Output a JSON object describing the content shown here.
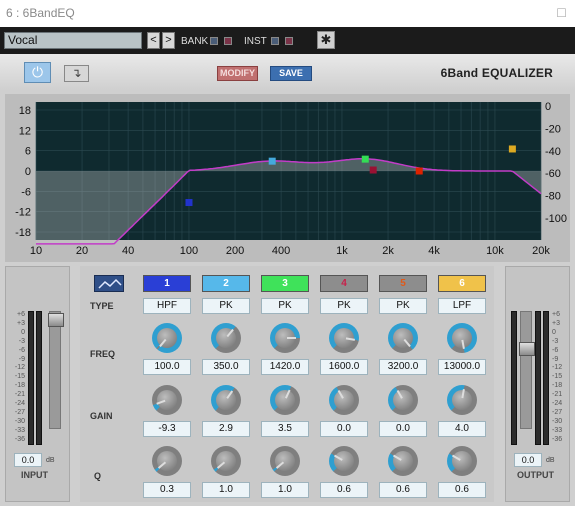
{
  "window": {
    "title": "6 : 6BandEQ",
    "close_glyph": "□"
  },
  "toolbar": {
    "preset": "Vocal",
    "prev": "<",
    "next": ">",
    "bank_label": "BANK",
    "inst_label": "INST",
    "gear_glyph": "✱"
  },
  "header": {
    "power_glyph": "⏻",
    "bypass_glyph": "↴",
    "modify_label": "MODIFY",
    "save_label": "SAVE",
    "brand": "6Band EQUALIZER"
  },
  "graph": {
    "left_ticks": [
      "18",
      "12",
      "6",
      "0",
      "-6",
      "-12",
      "-18"
    ],
    "right_ticks": [
      "0",
      "-20",
      "-40",
      "-60",
      "-80",
      "-100"
    ],
    "freq_ticks": [
      "10",
      "20",
      "40",
      "100",
      "200",
      "400",
      "1k",
      "2k",
      "4k",
      "10k",
      "20k"
    ],
    "curve_color": "#c23cc8",
    "node_colors": [
      "#2233cc",
      "#44aadd",
      "#33dd55",
      "#991133",
      "#dd2200",
      "#ddaa22"
    ],
    "nodes": [
      {
        "freq": 100,
        "gain": -9.3
      },
      {
        "freq": 350,
        "gain": 2.9
      },
      {
        "freq": 1420,
        "gain": 3.5
      },
      {
        "freq": 1600,
        "gain": 0.0
      },
      {
        "freq": 3200,
        "gain": 0.0
      },
      {
        "freq": 13000,
        "gain": 4.0
      }
    ]
  },
  "rows": {
    "type": "TYPE",
    "freq": "FREQ",
    "gain": "GAIN",
    "q": "Q"
  },
  "bands": [
    {
      "num": "1",
      "color": "#2a3fd6",
      "text_color": "#ffffff",
      "type": "HPF",
      "freq": "100.0",
      "gain": "-9.3",
      "q": "0.3"
    },
    {
      "num": "2",
      "color": "#56b8ea",
      "text_color": "#ffffff",
      "type": "PK",
      "freq": "350.0",
      "gain": "2.9",
      "q": "1.0"
    },
    {
      "num": "3",
      "color": "#3fe25a",
      "text_color": "#ffffff",
      "type": "PK",
      "freq": "1420.0",
      "gain": "3.5",
      "q": "1.0"
    },
    {
      "num": "4",
      "color": "#8d8d8d",
      "text_color": "#c8204a",
      "type": "PK",
      "freq": "1600.0",
      "gain": "0.0",
      "q": "0.6"
    },
    {
      "num": "5",
      "color": "#8d8d8d",
      "text_color": "#e05a1a",
      "type": "PK",
      "freq": "3200.0",
      "gain": "0.0",
      "q": "0.6"
    },
    {
      "num": "6",
      "color": "#f0c24a",
      "text_color": "#ffffff",
      "type": "LPF",
      "freq": "13000.0",
      "gain": "4.0",
      "q": "0.6"
    }
  ],
  "meter_scale": [
    "+6",
    "+3",
    "0",
    "-3",
    "-6",
    "-9",
    "-12",
    "-15",
    "-18",
    "-21",
    "-24",
    "-27",
    "-30",
    "-33",
    "-36"
  ],
  "input": {
    "label": "INPUT",
    "value": "0.0",
    "unit": "dB"
  },
  "output": {
    "label": "OUTPUT",
    "value": "0.0",
    "unit": "dB"
  },
  "curve_icon": "curve-view-icon"
}
